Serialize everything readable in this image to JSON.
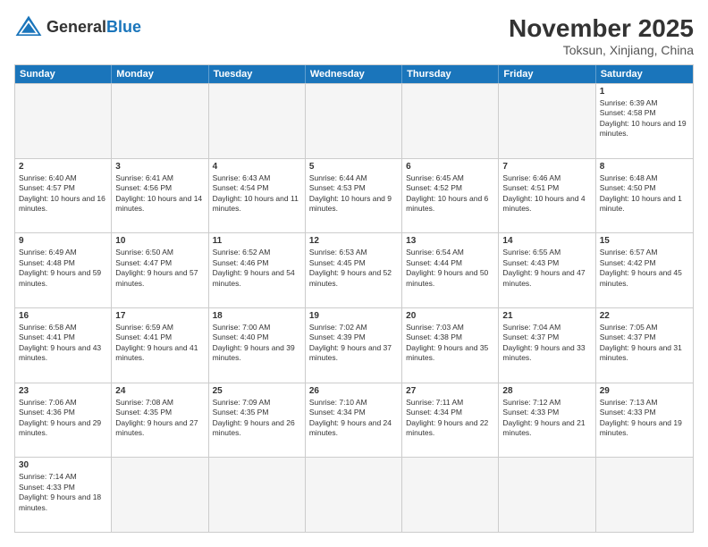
{
  "header": {
    "logo_general": "General",
    "logo_blue": "Blue",
    "month_title": "November 2025",
    "subtitle": "Toksun, Xinjiang, China"
  },
  "calendar": {
    "days_of_week": [
      "Sunday",
      "Monday",
      "Tuesday",
      "Wednesday",
      "Thursday",
      "Friday",
      "Saturday"
    ],
    "rows": [
      [
        {
          "day": "",
          "empty": true
        },
        {
          "day": "",
          "empty": true
        },
        {
          "day": "",
          "empty": true
        },
        {
          "day": "",
          "empty": true
        },
        {
          "day": "",
          "empty": true
        },
        {
          "day": "",
          "empty": true
        },
        {
          "day": "1",
          "info": "Sunrise: 6:39 AM\nSunset: 4:58 PM\nDaylight: 10 hours and 19 minutes."
        }
      ],
      [
        {
          "day": "2",
          "info": "Sunrise: 6:40 AM\nSunset: 4:57 PM\nDaylight: 10 hours and 16 minutes."
        },
        {
          "day": "3",
          "info": "Sunrise: 6:41 AM\nSunset: 4:56 PM\nDaylight: 10 hours and 14 minutes."
        },
        {
          "day": "4",
          "info": "Sunrise: 6:43 AM\nSunset: 4:54 PM\nDaylight: 10 hours and 11 minutes."
        },
        {
          "day": "5",
          "info": "Sunrise: 6:44 AM\nSunset: 4:53 PM\nDaylight: 10 hours and 9 minutes."
        },
        {
          "day": "6",
          "info": "Sunrise: 6:45 AM\nSunset: 4:52 PM\nDaylight: 10 hours and 6 minutes."
        },
        {
          "day": "7",
          "info": "Sunrise: 6:46 AM\nSunset: 4:51 PM\nDaylight: 10 hours and 4 minutes."
        },
        {
          "day": "8",
          "info": "Sunrise: 6:48 AM\nSunset: 4:50 PM\nDaylight: 10 hours and 1 minute."
        }
      ],
      [
        {
          "day": "9",
          "info": "Sunrise: 6:49 AM\nSunset: 4:48 PM\nDaylight: 9 hours and 59 minutes."
        },
        {
          "day": "10",
          "info": "Sunrise: 6:50 AM\nSunset: 4:47 PM\nDaylight: 9 hours and 57 minutes."
        },
        {
          "day": "11",
          "info": "Sunrise: 6:52 AM\nSunset: 4:46 PM\nDaylight: 9 hours and 54 minutes."
        },
        {
          "day": "12",
          "info": "Sunrise: 6:53 AM\nSunset: 4:45 PM\nDaylight: 9 hours and 52 minutes."
        },
        {
          "day": "13",
          "info": "Sunrise: 6:54 AM\nSunset: 4:44 PM\nDaylight: 9 hours and 50 minutes."
        },
        {
          "day": "14",
          "info": "Sunrise: 6:55 AM\nSunset: 4:43 PM\nDaylight: 9 hours and 47 minutes."
        },
        {
          "day": "15",
          "info": "Sunrise: 6:57 AM\nSunset: 4:42 PM\nDaylight: 9 hours and 45 minutes."
        }
      ],
      [
        {
          "day": "16",
          "info": "Sunrise: 6:58 AM\nSunset: 4:41 PM\nDaylight: 9 hours and 43 minutes."
        },
        {
          "day": "17",
          "info": "Sunrise: 6:59 AM\nSunset: 4:41 PM\nDaylight: 9 hours and 41 minutes."
        },
        {
          "day": "18",
          "info": "Sunrise: 7:00 AM\nSunset: 4:40 PM\nDaylight: 9 hours and 39 minutes."
        },
        {
          "day": "19",
          "info": "Sunrise: 7:02 AM\nSunset: 4:39 PM\nDaylight: 9 hours and 37 minutes."
        },
        {
          "day": "20",
          "info": "Sunrise: 7:03 AM\nSunset: 4:38 PM\nDaylight: 9 hours and 35 minutes."
        },
        {
          "day": "21",
          "info": "Sunrise: 7:04 AM\nSunset: 4:37 PM\nDaylight: 9 hours and 33 minutes."
        },
        {
          "day": "22",
          "info": "Sunrise: 7:05 AM\nSunset: 4:37 PM\nDaylight: 9 hours and 31 minutes."
        }
      ],
      [
        {
          "day": "23",
          "info": "Sunrise: 7:06 AM\nSunset: 4:36 PM\nDaylight: 9 hours and 29 minutes."
        },
        {
          "day": "24",
          "info": "Sunrise: 7:08 AM\nSunset: 4:35 PM\nDaylight: 9 hours and 27 minutes."
        },
        {
          "day": "25",
          "info": "Sunrise: 7:09 AM\nSunset: 4:35 PM\nDaylight: 9 hours and 26 minutes."
        },
        {
          "day": "26",
          "info": "Sunrise: 7:10 AM\nSunset: 4:34 PM\nDaylight: 9 hours and 24 minutes."
        },
        {
          "day": "27",
          "info": "Sunrise: 7:11 AM\nSunset: 4:34 PM\nDaylight: 9 hours and 22 minutes."
        },
        {
          "day": "28",
          "info": "Sunrise: 7:12 AM\nSunset: 4:33 PM\nDaylight: 9 hours and 21 minutes."
        },
        {
          "day": "29",
          "info": "Sunrise: 7:13 AM\nSunset: 4:33 PM\nDaylight: 9 hours and 19 minutes."
        }
      ],
      [
        {
          "day": "30",
          "info": "Sunrise: 7:14 AM\nSunset: 4:33 PM\nDaylight: 9 hours and 18 minutes."
        },
        {
          "day": "",
          "empty": true
        },
        {
          "day": "",
          "empty": true
        },
        {
          "day": "",
          "empty": true
        },
        {
          "day": "",
          "empty": true
        },
        {
          "day": "",
          "empty": true
        },
        {
          "day": "",
          "empty": true
        }
      ]
    ]
  }
}
